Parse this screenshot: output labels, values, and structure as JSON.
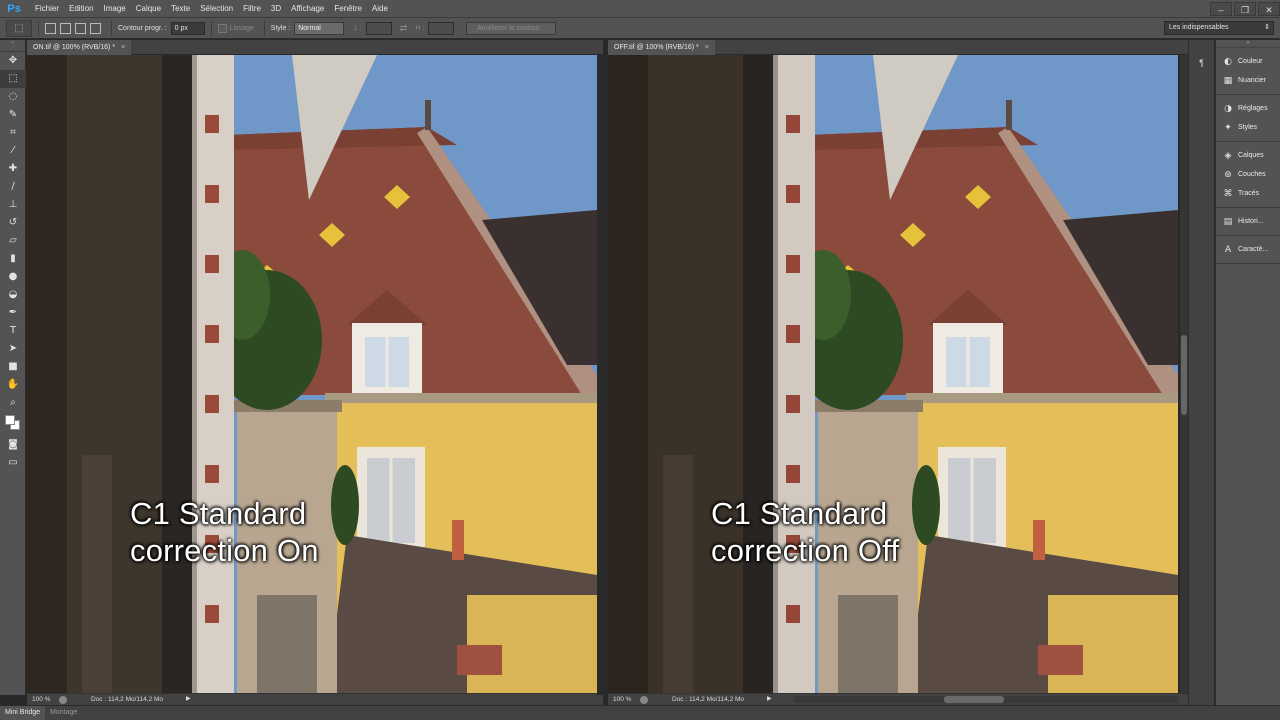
{
  "app": {
    "logo": "Ps"
  },
  "menu": [
    "Fichier",
    "Edition",
    "Image",
    "Calque",
    "Texte",
    "Sélection",
    "Filtre",
    "3D",
    "Affichage",
    "Fenêtre",
    "Aide"
  ],
  "window_controls": {
    "minimize": "–",
    "restore": "❐",
    "close": "✕"
  },
  "options": {
    "feather_label": "Contour progr. :",
    "feather_value": "0 px",
    "antialias_label": "Lissage",
    "style_label": "Style :",
    "style_value": "Normal",
    "width_label": "L :",
    "height_label": "H :",
    "refine_button": "Améliorer le contour...",
    "workspace": "Les indispensables"
  },
  "documents": [
    {
      "tab": "ON.tif @ 100% (RVB/16) *",
      "zoom": "100 %",
      "doc_info": "Doc : 114,2 Mo/114,2 Mo",
      "caption_line1": "C1 Standard",
      "caption_line2": "correction On"
    },
    {
      "tab": "OFF.tif @ 100% (RVB/16) *",
      "zoom": "100 %",
      "doc_info": "Doc : 114,2 Mo/114,2 Mo",
      "caption_line1": "C1 Standard",
      "caption_line2": "correction Off"
    }
  ],
  "panels": [
    {
      "label": "Couleur",
      "icon": "color-wheel-icon"
    },
    {
      "label": "Nuancier",
      "icon": "swatches-grid-icon"
    },
    {
      "label": "Réglages",
      "icon": "adjustments-icon"
    },
    {
      "label": "Styles",
      "icon": "styles-icon"
    },
    {
      "label": "Calques",
      "icon": "layers-icon"
    },
    {
      "label": "Couches",
      "icon": "channels-icon"
    },
    {
      "label": "Tracés",
      "icon": "paths-icon"
    },
    {
      "label": "Histori...",
      "icon": "history-icon"
    },
    {
      "label": "Caractè...",
      "icon": "character-icon"
    }
  ],
  "bridge_tabs": [
    "Mini Bridge",
    "Montage"
  ],
  "colors": {
    "sky": "#6f98c8",
    "roof": "#8a4a3c",
    "wall_yellow": "#e3be59",
    "ui_panel": "#535353",
    "ui_dark": "#282828"
  }
}
